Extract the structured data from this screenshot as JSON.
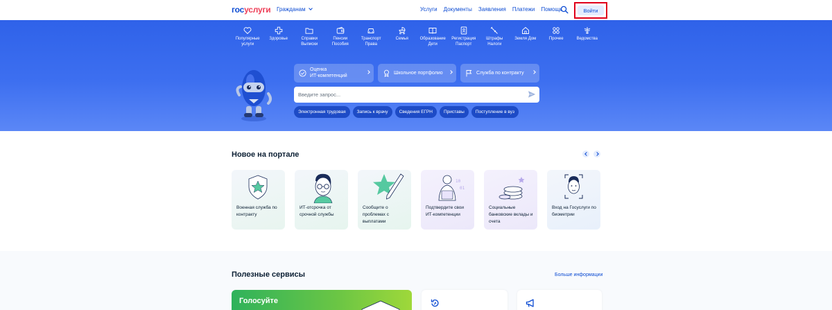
{
  "header": {
    "logo_part1": "гос",
    "logo_part2": "услуги",
    "audience": "Гражданам",
    "nav": [
      "Услуги",
      "Документы",
      "Заявления",
      "Платежи",
      "Помощь"
    ],
    "login": "Войти",
    "accent": "#0d4cd3",
    "highlight": "#e0001a"
  },
  "hero": {
    "categories": [
      {
        "l1": "Популярные",
        "l2": "услуги",
        "icon": "heart-icon"
      },
      {
        "l1": "Здоровье",
        "l2": "",
        "icon": "medical-cross-icon"
      },
      {
        "l1": "Справки",
        "l2": "Выписки",
        "icon": "folder-icon"
      },
      {
        "l1": "Пенсии",
        "l2": "Пособия",
        "icon": "wallet-icon"
      },
      {
        "l1": "Транспорт",
        "l2": "Права",
        "icon": "car-icon"
      },
      {
        "l1": "Семья",
        "l2": "",
        "icon": "stroller-icon"
      },
      {
        "l1": "Образование",
        "l2": "Дети",
        "icon": "book-icon"
      },
      {
        "l1": "Регистрация",
        "l2": "Паспорт",
        "icon": "passport-icon"
      },
      {
        "l1": "Штрафы",
        "l2": "Налоги",
        "icon": "scales-icon"
      },
      {
        "l1": "Земля Дом",
        "l2": "",
        "icon": "house-icon"
      },
      {
        "l1": "Прочее",
        "l2": "",
        "icon": "grid-icon"
      },
      {
        "l1": "Ведомства",
        "l2": "",
        "icon": "emblem-icon"
      }
    ],
    "quick_tiles": [
      {
        "l1": "Оценка",
        "l2": "ИТ-компетенций",
        "icon": "check-circle-icon"
      },
      {
        "l1": "Школьное портфолио",
        "l2": "",
        "icon": "medal-icon"
      },
      {
        "l1": "Служба по контракту",
        "l2": "",
        "icon": "flag-icon"
      }
    ],
    "search_placeholder": "Введите запрос...",
    "chips": [
      "Электронная трудовая",
      "Запись к врачу",
      "Сведения ЕГРН",
      "Приставы",
      "Поступление в вуз"
    ]
  },
  "news": {
    "title": "Новое на портале",
    "cards": [
      {
        "text": "Военная служба по контракту",
        "bg": "#edf6f1",
        "icon": "shield-star-icon"
      },
      {
        "text": "ИТ-отсрочка от срочной службы",
        "bg": "#edf6f3",
        "icon": "person-glasses-icon"
      },
      {
        "text": "Сообщите о проблемах с выплатами",
        "bg": "#edf6f1",
        "icon": "star-pencil-icon"
      },
      {
        "text": "Подтвердите свои ИТ-компетенции",
        "bg": "#f1effa",
        "icon": "developer-icon"
      },
      {
        "text": "Социальные банковские вклады и счета",
        "bg": "#f1effa",
        "icon": "coins-icon"
      },
      {
        "text": "Вход на Госуслуги по биометрии",
        "bg": "#edf3fb",
        "icon": "face-scan-icon"
      }
    ]
  },
  "services": {
    "title": "Полезные сервисы",
    "more": "Больше информации",
    "vote_title": "Голосуйте"
  }
}
